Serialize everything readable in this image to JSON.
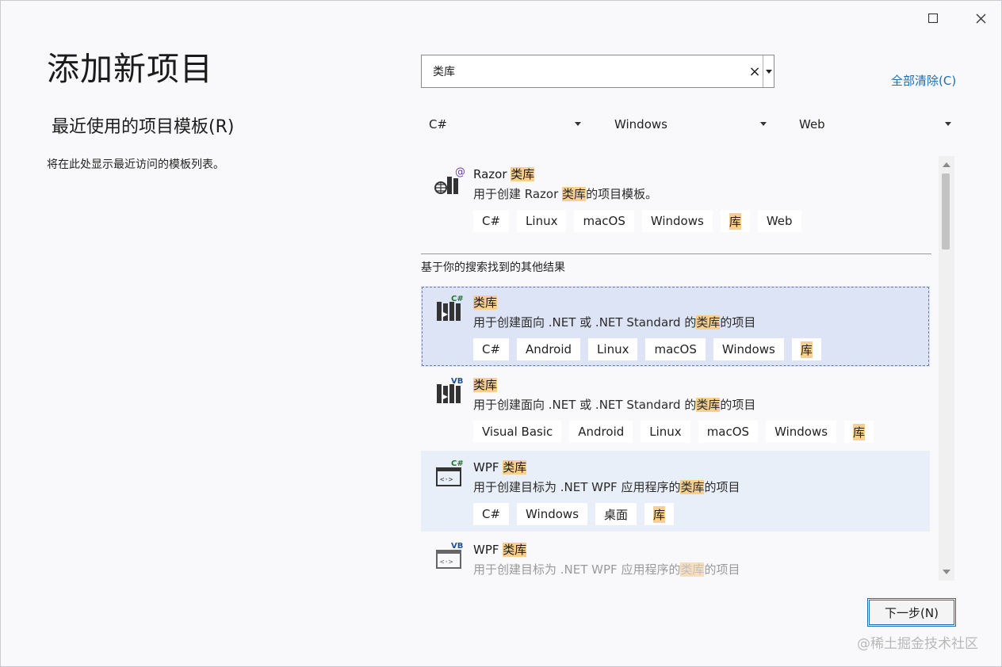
{
  "window": {
    "maximize_icon": "maximize-icon",
    "close_icon": "close-icon"
  },
  "title": "添加新项目",
  "recent": {
    "heading": "最近使用的项目模板(R)",
    "empty_text": "将在此处显示最近访问的模板列表。"
  },
  "search": {
    "value": "类库",
    "clear_icon": "×"
  },
  "clear_all": "全部清除(C)",
  "filters": [
    {
      "value": "C#"
    },
    {
      "value": "Windows"
    },
    {
      "value": "Web"
    }
  ],
  "section_label": "基于你的搜索找到的其他结果",
  "templates": [
    {
      "title_prefix": "Razor ",
      "title_hl": "类库",
      "desc_prefix": "用于创建 Razor ",
      "desc_hl": "类库",
      "desc_suffix": "的项目模板。",
      "tags": [
        "C#",
        "Linux",
        "macOS",
        "Windows",
        "库",
        "Web"
      ],
      "icon": "razor-library-icon"
    },
    {
      "title_prefix": "",
      "title_hl": "类库",
      "desc_prefix": "用于创建面向 .NET 或 .NET Standard 的",
      "desc_hl": "类库",
      "desc_suffix": "的项目",
      "tags": [
        "C#",
        "Android",
        "Linux",
        "macOS",
        "Windows",
        "库"
      ],
      "icon": "csharp-library-icon"
    },
    {
      "title_prefix": "",
      "title_hl": "类库",
      "desc_prefix": "用于创建面向 .NET 或 .NET Standard 的",
      "desc_hl": "类库",
      "desc_suffix": "的项目",
      "tags": [
        "Visual Basic",
        "Android",
        "Linux",
        "macOS",
        "Windows",
        "库"
      ],
      "icon": "vb-library-icon"
    },
    {
      "title_prefix": "WPF ",
      "title_hl": "类库",
      "desc_prefix": "用于创建目标为 .NET WPF 应用程序的",
      "desc_hl": "类库",
      "desc_suffix": "的项目",
      "tags": [
        "C#",
        "Windows",
        "桌面",
        "库"
      ],
      "icon": "wpf-csharp-library-icon"
    },
    {
      "title_prefix": "WPF ",
      "title_hl": "类库",
      "desc_prefix": "用于创建目标为 .NET WPF 应用程序的",
      "desc_hl": "类库",
      "desc_suffix": "的项目",
      "tags": [],
      "icon": "wpf-vb-library-icon"
    }
  ],
  "next_button": "下一步(N)",
  "watermark": "@稀土掘金技术社区"
}
